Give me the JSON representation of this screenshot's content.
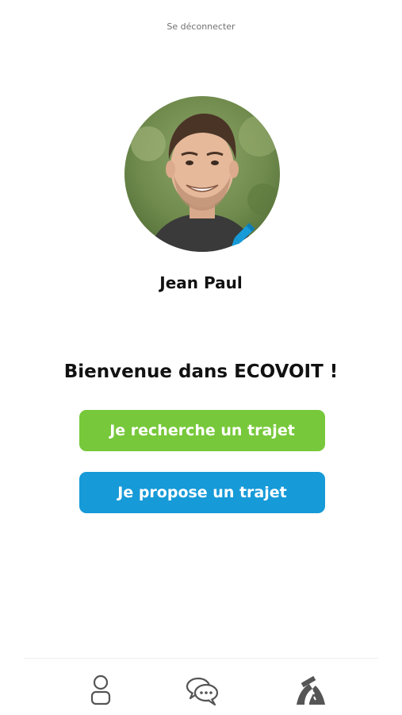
{
  "header": {
    "logout_label": "Se déconnecter"
  },
  "profile": {
    "name": "Jean Paul"
  },
  "main": {
    "welcome_text": "Bienvenue dans ECOVOIT !",
    "search_trip_label": "Je recherche un trajet",
    "offer_trip_label": "Je propose un trajet"
  },
  "tabbar": {
    "items": [
      {
        "icon": "user-icon"
      },
      {
        "icon": "chat-bubbles-icon"
      },
      {
        "icon": "road-icon"
      }
    ]
  },
  "colors": {
    "search_button": "#77c83a",
    "offer_button": "#169ad8",
    "edit_icon": "#169ad8",
    "tab_icon": "#555555"
  }
}
